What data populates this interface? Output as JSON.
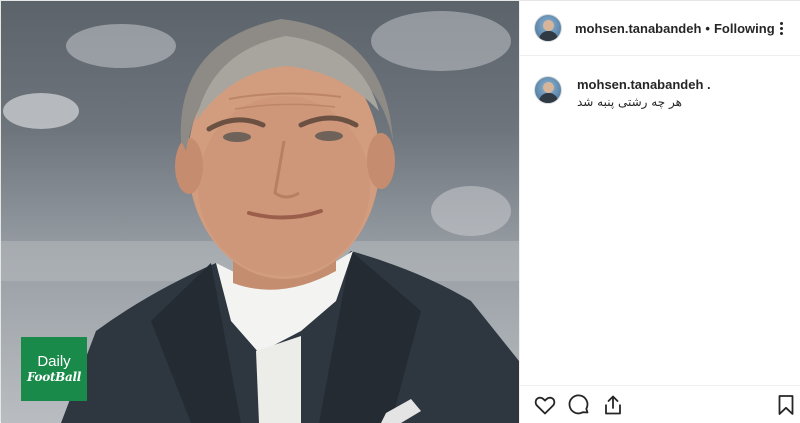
{
  "post": {
    "username": "mohsen.tanabandeh",
    "separator": "•",
    "follow_status": "Following",
    "more_icon": "more-options-icon"
  },
  "caption": {
    "username": "mohsen.tanabandeh .",
    "text": "هر چه رشتی پنبه شد"
  },
  "watermark": {
    "line1": "Daily",
    "line2": "FootBall"
  },
  "actions": [
    "heart-icon",
    "comment-icon",
    "share-icon",
    "bookmark-icon"
  ],
  "colors": {
    "logo_green": "#1a8a4a",
    "border": "#efefef",
    "text": "#262626"
  }
}
